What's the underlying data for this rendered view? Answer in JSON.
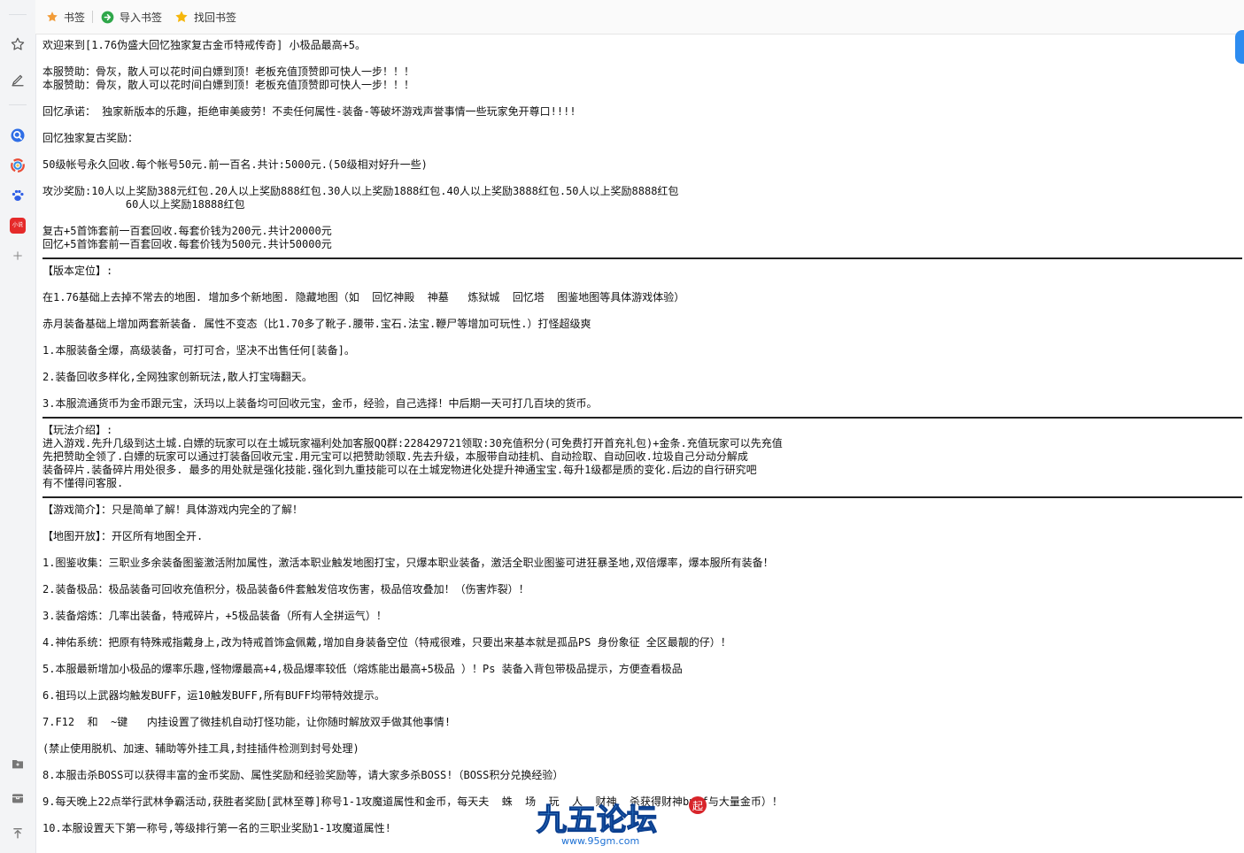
{
  "sidebar": {
    "icons": [
      "star-icon",
      "notes-icon",
      "search-app-icon",
      "browser-app-icon",
      "paw-app-icon",
      "red-app-icon",
      "add-icon"
    ],
    "red_app_label": "小说",
    "bottom_icons": [
      "folder-icon",
      "toolbox-icon",
      "pin-icon"
    ]
  },
  "bookmark_bar": {
    "items": [
      {
        "label": "书签",
        "icon": "star-icon",
        "color": "#f29c38"
      },
      {
        "label": "导入书签",
        "icon": "arrow-right-icon",
        "color": "#2fa74a"
      },
      {
        "label": "找回书签",
        "icon": "star-icon",
        "color": "#f5b60b"
      }
    ]
  },
  "watermark": {
    "text": "九五论坛",
    "url": "www.95gm.com",
    "badge": "起"
  },
  "content": {
    "lines": [
      "欢迎来到[1.76伪盛大回忆独家复古金币特戒传奇] 小极品最高+5。",
      "",
      "本服赞助：骨灰，散人可以花时间白嫖到顶！老板充值顶赞即可快人一步！！！",
      "本服赞助：骨灰，散人可以花时间白嫖到顶！老板充值顶赞即可快人一步！！！",
      "",
      "回忆承诺： 独家新版本的乐趣，拒绝审美疲劳！不卖任何属性-装备-等破坏游戏声誉事情一些玩家免开尊口!!!!",
      "",
      "回忆独家复古奖励：",
      "",
      "50级帐号永久回收.每个帐号50元.前一百名.共计:5000元.(50级相对好升一些)",
      "",
      "攻沙奖励:10人以上奖励388元红包.20人以上奖励888红包.30人以上奖励1888红包.40人以上奖励3888红包.50人以上奖励8888红包",
      "             60人以上奖励18888红包",
      "",
      "复古+5首饰套前一百套回收.每套价钱为200元.共计20000元",
      "回忆+5首饰套前一百套回收.每套价钱为500元.共计50000元",
      "---",
      "【版本定位】:",
      "",
      "在1.76基础上去掉不常去的地图. 增加多个新地图. 隐藏地图（如  回忆神殿  神墓   炼狱城  回忆塔  图鉴地图等具体游戏体验）",
      "",
      "赤月装备基础上增加两套新装备. 属性不变态（比1.70多了靴子.腰带.宝石.法宝.鞭尸等增加可玩性.）打怪超级爽",
      "",
      "1.本服装备全爆，高级装备，可打可合，坚决不出售任何[装备]。",
      "",
      "2.装备回收多样化,全网独家创新玩法,散人打宝嗨翻天。",
      "",
      "3.本服流通货币为金币跟元宝，沃玛以上装备均可回收元宝，金币，经验，自己选择！中后期一天可打几百块的货币。",
      "---",
      "【玩法介绍】:",
      "进入游戏.先升几级到达土城.白嫖的玩家可以在土城玩家福利处加客服QQ群:228429721领取:30充值积分(可免费打开首充礼包)+金条.充值玩家可以先充值",
      "先把赞助全领了.白嫖的玩家可以通过打装备回收元宝.用元宝可以把赞助领取.先去升级，本服带自动挂机、自动捡取、自动回收.垃圾自己分动分解成",
      "装备碎片.装备碎片用处很多. 最多的用处就是强化技能.强化到九重技能可以在土城宠物进化处提升神通宝宝.每升1级都是质的变化.后边的自行研究吧",
      "有不懂得问客服.",
      "---",
      "【游戏简介】：只是简单了解！具体游戏内完全的了解！",
      "",
      "【地图开放】：开区所有地图全开.",
      "",
      "1.图鉴收集：三职业多余装备图鉴激活附加属性，激活本职业触发地图打宝，只爆本职业装备，激活全职业图鉴可进狂暴圣地,双倍爆率，爆本服所有装备！",
      "",
      "2.装备极品：极品装备可回收充值积分，极品装备6件套触发倍攻伤害，极品倍攻叠加！（伤害炸裂）！",
      "",
      "3.装备熔炼：几率出装备，特戒碎片，+5极品装备（所有人全拼运气）！",
      "",
      "4.神佑系统：把原有特殊戒指戴身上,改为特戒首饰盒佩戴,增加自身装备空位（特戒很难，只要出来基本就是孤品PS 身份象征 全区最靓的仔）！",
      "",
      "5.本服最新增加小极品的爆率乐趣,怪物爆最高+4,极品爆率较低（熔炼能出最高+5极品 ）！Ps 装备入背包带极品提示，方便查看极品",
      "",
      "6.祖玛以上武器均触发BUFF，运10触发BUFF,所有BUFF均带特效提示。",
      "",
      "7.F12  和  ~键   内挂设置了微挂机自动打怪功能，让你随时解放双手做其他事情!",
      "",
      "(禁止使用脱机、加速、辅助等外挂工具,封挂插件检测到封号处理)",
      "",
      "8.本服击杀BOSS可以获得丰富的金币奖励、属性奖励和经验奖励等，请大家多杀BOSS!（BOSS积分兑换经验）",
      "",
      "9.每天晚上22点举行武林争霸活动,获胜者奖励[武林至尊]称号1-1攻魔道属性和金币，每天夫  蛛  场  玩  人  财神  杀获得财神buff与大量金币）！",
      "",
      "10.本服设置天下第一称号,等级排行第一名的三职业奖励1-1攻魔道属性!"
    ]
  }
}
